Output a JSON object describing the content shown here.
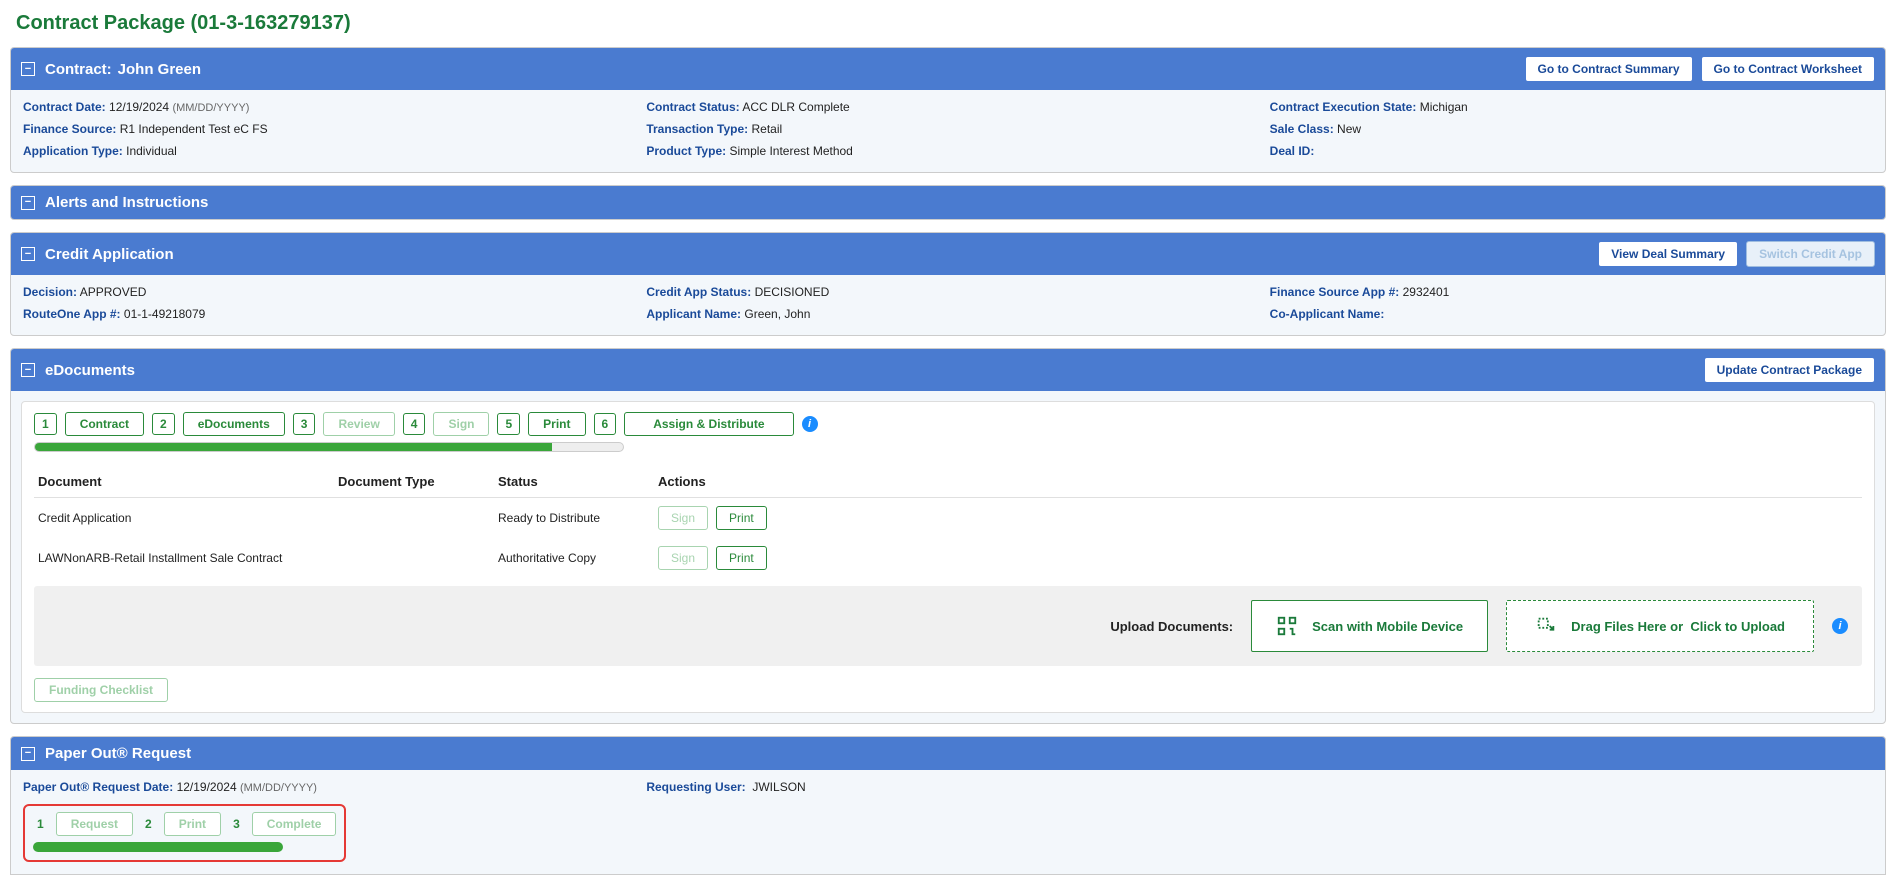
{
  "page": {
    "title": "Contract Package (01-3-163279137)"
  },
  "contract_panel": {
    "header_prefix": "Contract:",
    "header_name": "John Green",
    "btn_summary": "Go to Contract Summary",
    "btn_worksheet": "Go to Contract Worksheet",
    "fields": {
      "contract_date_label": "Contract Date:",
      "contract_date_value": "12/19/2024",
      "contract_date_hint": "(MM/DD/YYYY)",
      "finance_source_label": "Finance Source:",
      "finance_source_value": "R1 Independent Test eC FS",
      "application_type_label": "Application Type:",
      "application_type_value": "Individual",
      "contract_status_label": "Contract Status:",
      "contract_status_value": "ACC DLR Complete",
      "transaction_type_label": "Transaction Type:",
      "transaction_type_value": "Retail",
      "product_type_label": "Product Type:",
      "product_type_value": "Simple Interest Method",
      "exec_state_label": "Contract Execution State:",
      "exec_state_value": "Michigan",
      "sale_class_label": "Sale Class:",
      "sale_class_value": "New",
      "deal_id_label": "Deal ID:",
      "deal_id_value": ""
    }
  },
  "alerts_panel": {
    "title": "Alerts and Instructions"
  },
  "credit_panel": {
    "title": "Credit Application",
    "btn_view_deal": "View Deal Summary",
    "btn_switch": "Switch Credit App",
    "fields": {
      "decision_label": "Decision:",
      "decision_value": "APPROVED",
      "r1app_label": "RouteOne App #:",
      "r1app_value": "01-1-49218079",
      "credit_status_label": "Credit App Status:",
      "credit_status_value": "DECISIONED",
      "applicant_label": "Applicant Name:",
      "applicant_value": "Green, John",
      "fs_app_label": "Finance Source App #:",
      "fs_app_value": "2932401",
      "coapp_label": "Co-Applicant Name:",
      "coapp_value": ""
    }
  },
  "edoc_panel": {
    "title": "eDocuments",
    "btn_update": "Update Contract Package",
    "steps": [
      {
        "num": "1",
        "label": "Contract",
        "muted": false
      },
      {
        "num": "2",
        "label": "eDocuments",
        "muted": false
      },
      {
        "num": "3",
        "label": "Review",
        "muted": true
      },
      {
        "num": "4",
        "label": "Sign",
        "muted": true
      },
      {
        "num": "5",
        "label": "Print",
        "muted": false
      },
      {
        "num": "6",
        "label": "Assign & Distribute",
        "muted": false
      }
    ],
    "progress_pct": 88,
    "table": {
      "col_doc": "Document",
      "col_type": "Document Type",
      "col_status": "Status",
      "col_actions": "Actions",
      "rows": [
        {
          "doc": "Credit Application",
          "type": "",
          "status": "Ready to Distribute",
          "sign": "Sign",
          "print": "Print"
        },
        {
          "doc": "LAWNonARB-Retail Installment Sale Contract",
          "type": "",
          "status": "Authoritative Copy",
          "sign": "Sign",
          "print": "Print"
        }
      ]
    },
    "upload": {
      "label": "Upload Documents:",
      "scan": "Scan with Mobile Device",
      "drop_a": "Drag Files Here or",
      "drop_b": "Click to Upload"
    },
    "funding_checklist": "Funding Checklist"
  },
  "paperout_panel": {
    "title": "Paper Out® Request",
    "date_label": "Paper Out® Request Date:",
    "date_value": "12/19/2024",
    "date_hint": "(MM/DD/YYYY)",
    "user_label": "Requesting User:",
    "user_value": "JWILSON",
    "steps": [
      {
        "num": "1",
        "label": "Request"
      },
      {
        "num": "2",
        "label": "Print"
      },
      {
        "num": "3",
        "label": "Complete"
      }
    ]
  }
}
